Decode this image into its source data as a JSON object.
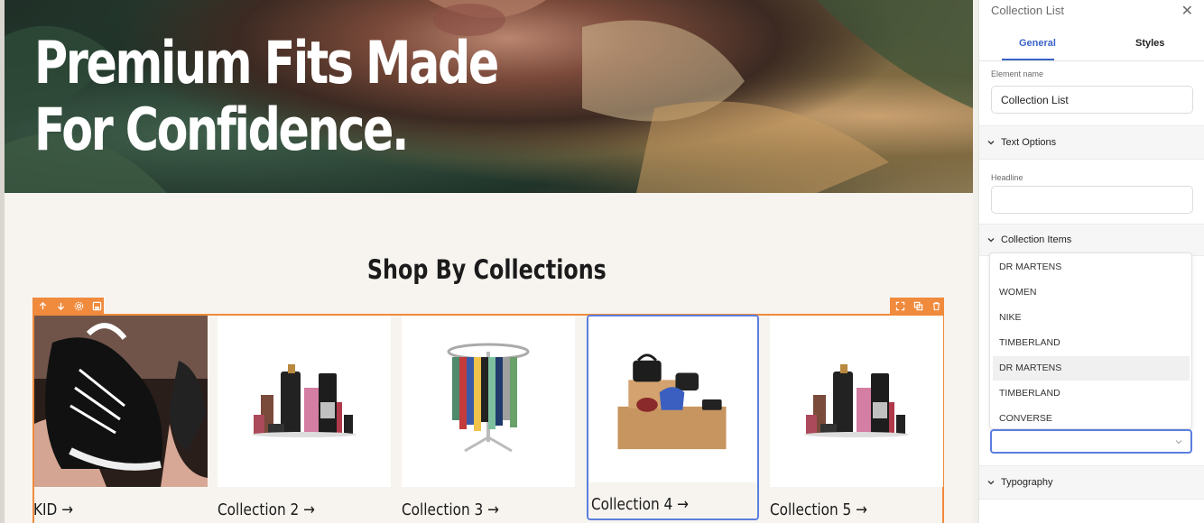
{
  "hero": {
    "title_line1": "Premium Fits Made",
    "title_line2": "For Confidence."
  },
  "section": {
    "title": "Shop By Collections"
  },
  "toolbar": {
    "left": [
      "arrow-up-icon",
      "arrow-down-icon",
      "gear-icon",
      "save-icon"
    ],
    "right": [
      "expand-icon",
      "duplicate-icon",
      "trash-icon"
    ]
  },
  "collections": [
    {
      "label": "KID →",
      "image": "sneaker-photo"
    },
    {
      "label": "Collection 2 →",
      "image": "cosmetics-illustration"
    },
    {
      "label": "Collection 3 →",
      "image": "clothing-rack-illustration"
    },
    {
      "label": "Collection 4 →",
      "image": "bags-boxes-illustration"
    },
    {
      "label": "Collection 5 →",
      "image": "cosmetics-illustration"
    }
  ],
  "panel": {
    "title": "Collection List",
    "tabs": {
      "general": "General",
      "styles": "Styles"
    },
    "element_name_label": "Element name",
    "element_name_value": "Collection List",
    "text_options": "Text Options",
    "headline_label": "Headline",
    "headline_value": "",
    "collection_items": "Collection Items",
    "typography": "Typography",
    "dropdown_items": [
      "DR MARTENS",
      "WOMEN",
      "NIKE",
      "TIMBERLAND",
      "DR MARTENS",
      "TIMBERLAND",
      "CONVERSE"
    ],
    "dropdown_highlight_index": 4,
    "dropdown_value": ""
  },
  "colors": {
    "accent": "#f08a3c",
    "selection": "#5b7fe0",
    "tab_active": "#3a64c8"
  }
}
